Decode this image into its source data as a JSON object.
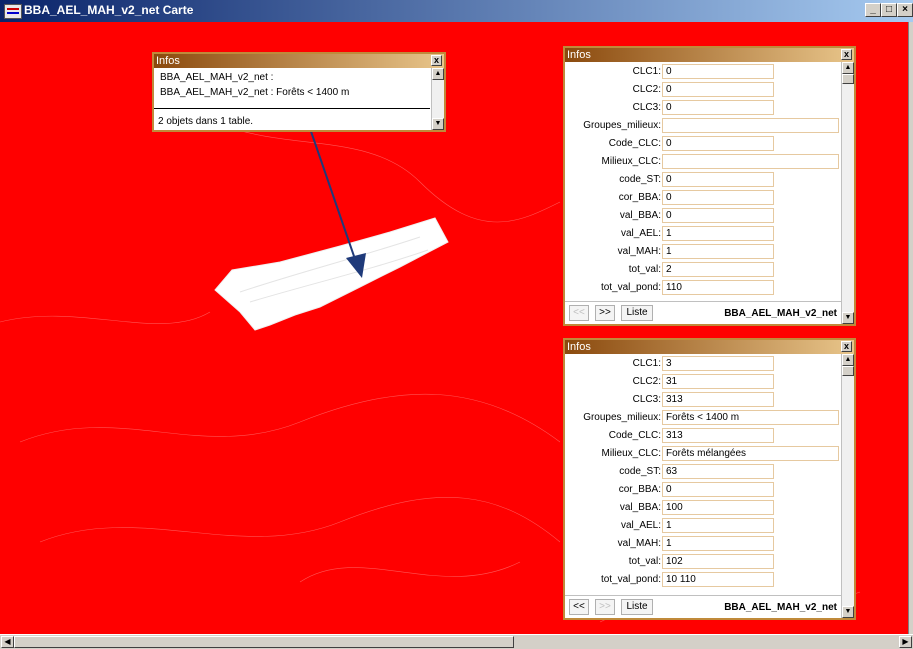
{
  "window": {
    "title": "BBA_AEL_MAH_v2_net Carte",
    "controls": [
      "_",
      "□",
      "×"
    ]
  },
  "info_small": {
    "title": "Infos",
    "items": [
      "BBA_AEL_MAH_v2_net :",
      "BBA_AEL_MAH_v2_net : Forêts < 1400 m"
    ],
    "status": "2 objets dans 1 table."
  },
  "info_top": {
    "title": "Infos",
    "fields": [
      {
        "label": "CLC1:",
        "value": "0",
        "wide": false
      },
      {
        "label": "CLC2:",
        "value": "0",
        "wide": false
      },
      {
        "label": "CLC3:",
        "value": "0",
        "wide": false
      },
      {
        "label": "Groupes_milieux:",
        "value": "",
        "wide": true
      },
      {
        "label": "Code_CLC:",
        "value": "0",
        "wide": false
      },
      {
        "label": "Milieux_CLC:",
        "value": "",
        "wide": true
      },
      {
        "label": "code_ST:",
        "value": "0",
        "wide": false
      },
      {
        "label": "cor_BBA:",
        "value": "0",
        "wide": false
      },
      {
        "label": "val_BBA:",
        "value": "0",
        "wide": false
      },
      {
        "label": "val_AEL:",
        "value": "1",
        "wide": false
      },
      {
        "label": "val_MAH:",
        "value": "1",
        "wide": false
      },
      {
        "label": "tot_val:",
        "value": "2",
        "wide": false
      },
      {
        "label": "tot_val_pond:",
        "value": "110",
        "wide": false
      }
    ],
    "prev": "<<",
    "next": ">>",
    "list": "Liste",
    "table": "BBA_AEL_MAH_v2_net"
  },
  "info_bottom": {
    "title": "Infos",
    "fields": [
      {
        "label": "CLC1:",
        "value": "3",
        "wide": false
      },
      {
        "label": "CLC2:",
        "value": "31",
        "wide": false
      },
      {
        "label": "CLC3:",
        "value": "313",
        "wide": false
      },
      {
        "label": "Groupes_milieux:",
        "value": "Forêts < 1400 m",
        "wide": true
      },
      {
        "label": "Code_CLC:",
        "value": "313",
        "wide": false
      },
      {
        "label": "Milieux_CLC:",
        "value": "Forêts mélangées",
        "wide": true
      },
      {
        "label": "code_ST:",
        "value": "63",
        "wide": false
      },
      {
        "label": "cor_BBA:",
        "value": "0",
        "wide": false
      },
      {
        "label": "val_BBA:",
        "value": "100",
        "wide": false
      },
      {
        "label": "val_AEL:",
        "value": "1",
        "wide": false
      },
      {
        "label": "val_MAH:",
        "value": "1",
        "wide": false
      },
      {
        "label": "tot_val:",
        "value": "102",
        "wide": false
      },
      {
        "label": "tot_val_pond:",
        "value": "10 110",
        "wide": false
      }
    ],
    "prev": "<<",
    "next": ">>",
    "list": "Liste",
    "table": "BBA_AEL_MAH_v2_net"
  },
  "colors": {
    "map_fill": "#ff0000",
    "selection": "#ffffff",
    "arrow": "#1f3a7a",
    "title_bar": "#0a246a"
  }
}
